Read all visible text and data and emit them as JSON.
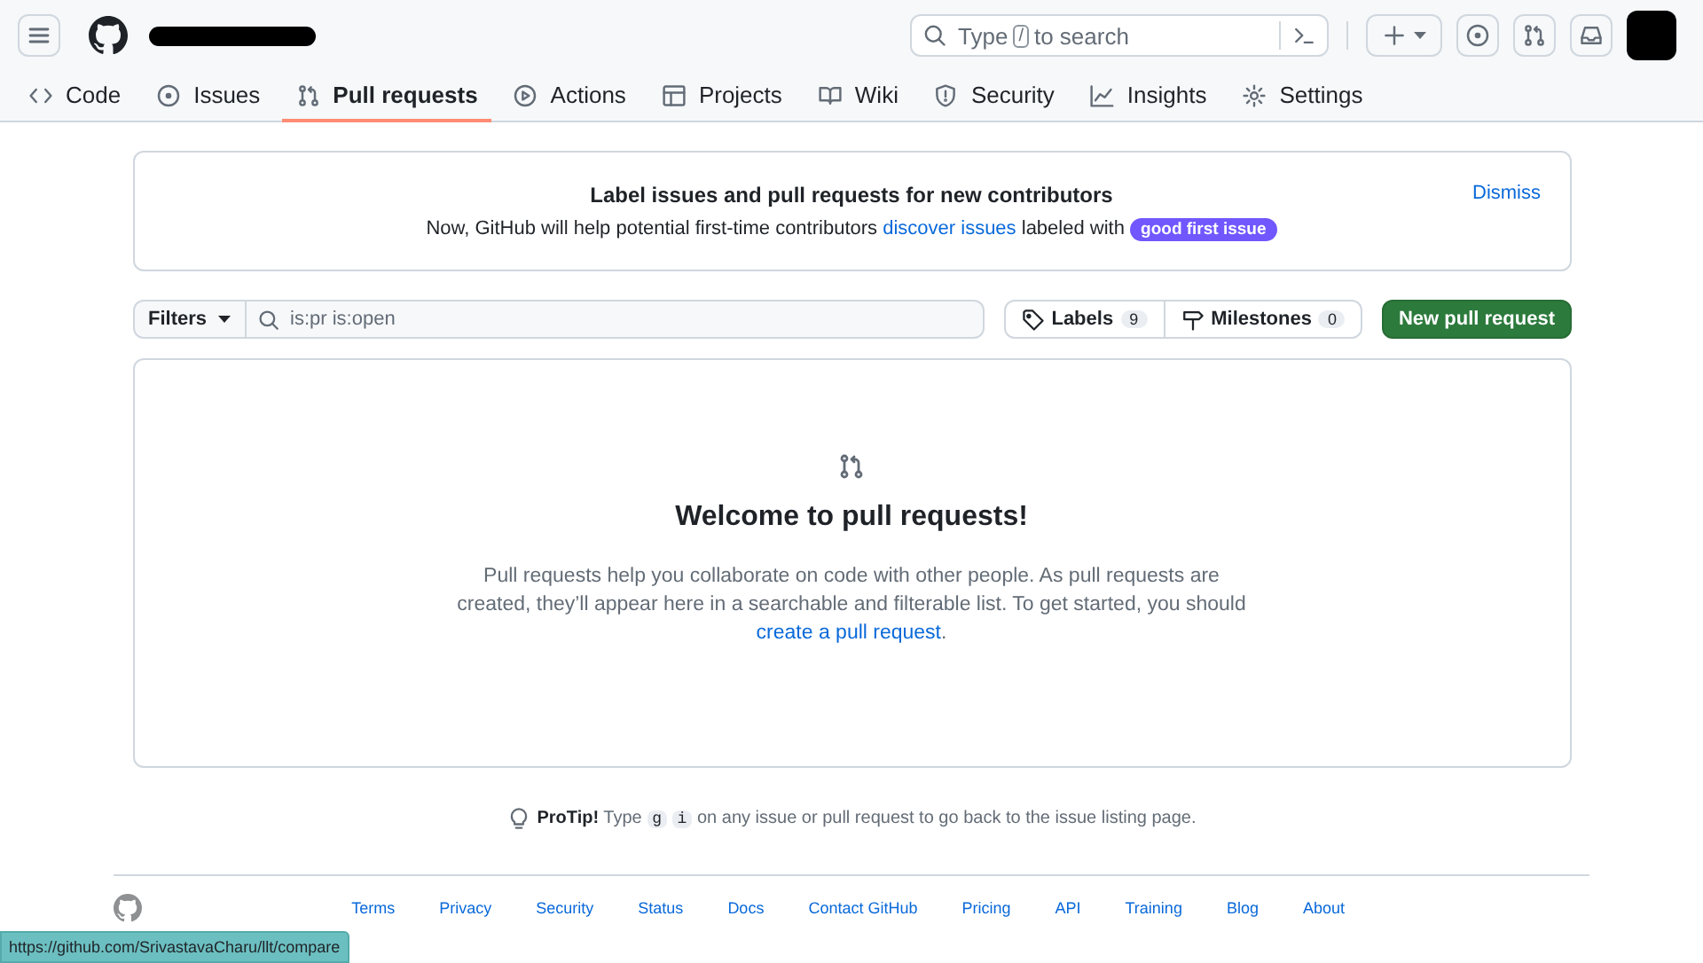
{
  "header": {
    "search": {
      "hint_before": "Type",
      "hint_key": "/",
      "hint_after": "to search"
    }
  },
  "tabs": [
    {
      "label": "Code",
      "selected": false
    },
    {
      "label": "Issues",
      "selected": false
    },
    {
      "label": "Pull requests",
      "selected": true
    },
    {
      "label": "Actions",
      "selected": false
    },
    {
      "label": "Projects",
      "selected": false
    },
    {
      "label": "Wiki",
      "selected": false
    },
    {
      "label": "Security",
      "selected": false
    },
    {
      "label": "Insights",
      "selected": false
    },
    {
      "label": "Settings",
      "selected": false
    }
  ],
  "banner": {
    "title": "Label issues and pull requests for new contributors",
    "text_before": "Now, GitHub will help potential first-time contributors",
    "link": "discover issues",
    "text_after": "labeled with",
    "label": {
      "text": "good first issue",
      "color": "#7057ff"
    },
    "dismiss": "Dismiss"
  },
  "toolbar": {
    "filters": "Filters",
    "query": "is:pr is:open",
    "labels": {
      "label": "Labels",
      "count": "9"
    },
    "milestones": {
      "label": "Milestones",
      "count": "0"
    },
    "new_button": "New pull request"
  },
  "blankslate": {
    "title": "Welcome to pull requests!",
    "text": "Pull requests help you collaborate on code with other people. As pull requests are created, they’ll appear here in a searchable and filterable list. To get started, you should",
    "link": "create a pull request",
    "text_end": "."
  },
  "protip": {
    "label": "ProTip!",
    "before": "Type",
    "keys": [
      "g",
      "i"
    ],
    "after": "on any issue or pull request to go back to the issue listing page."
  },
  "footer": {
    "links": [
      "Terms",
      "Privacy",
      "Security",
      "Status",
      "Docs",
      "Contact GitHub",
      "Pricing",
      "API",
      "Training",
      "Blog",
      "About"
    ]
  },
  "status_url": "https://github.com/SrivastavaCharu/llt/compare"
}
